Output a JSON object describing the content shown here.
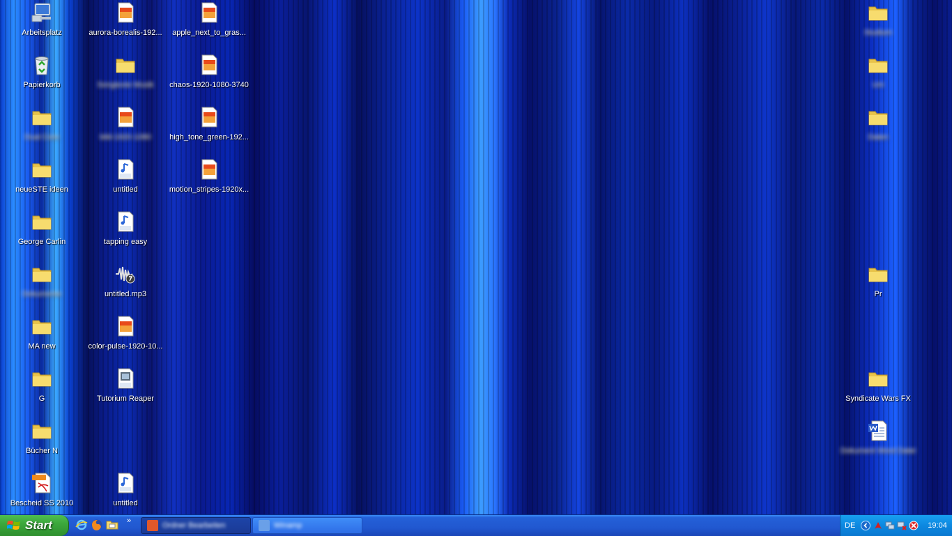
{
  "desktop": {
    "icons": {
      "arbeitsplatz": "Arbeitsplatz",
      "papierkorb": "Papierkorb",
      "folder_blurred_1": "Dual Core",
      "neuestE_ideen": "neueSTE ideen",
      "george_carlin": "George Carlin",
      "folder_blurred_2": "Dokumente",
      "ma_new": "MA new",
      "g": "G",
      "buecher_n": "Bücher N",
      "bescheid": "Bescheid SS 2010",
      "aurora": "aurora-borealis-192...",
      "folder_blurred_3": "Songtexte Musik",
      "image_blurred_1": "bild-1920-1080",
      "untitled_mp3_1": "untitled",
      "tapping_easy": "tapping easy",
      "untitled_mp3": "untitled.mp3",
      "color_pulse": "color-pulse-1920-10...",
      "tutorium_reaper": "Tutorium Reaper",
      "untitled_wav": "untitled",
      "apple_next": "apple_next_to_gras...",
      "chaos": "chaos-1920-1080-3740",
      "high_tone": "high_tone_green-192...",
      "motion_stripes": "motion_stripes-1920x...",
      "folder_right_blurred_1": "Studium",
      "folder_right_blurred_2": "Uni",
      "folder_right_blurred_3": "Daten",
      "pr": "Pr",
      "syndicate_wars": "Syndicate Wars FX",
      "word_doc_blurred": "Dokument Word Datei"
    }
  },
  "taskbar": {
    "start_label": "Start",
    "quicklaunch_more": "»",
    "tasks": [
      {
        "label": "Ordner Bearbeiten"
      },
      {
        "label": "Winamp"
      }
    ],
    "tray": {
      "language": "DE",
      "clock": "19:04"
    }
  },
  "colors": {
    "folder": "#f5d65a",
    "taskbar": "#2158d0",
    "start_green": "#3ca83c",
    "tray": "#0d88e0"
  }
}
